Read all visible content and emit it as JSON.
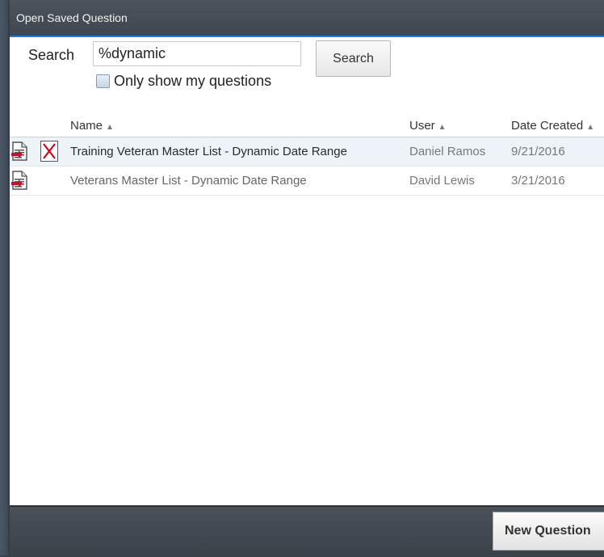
{
  "dialog": {
    "title": "Open Saved Question"
  },
  "search": {
    "label": "Search",
    "value": "%dynamic",
    "button_label": "Search",
    "only_mine_label": "Only show my questions",
    "only_mine_checked": false
  },
  "table": {
    "columns": [
      {
        "label": "Name",
        "sort": "asc"
      },
      {
        "label": "User",
        "sort": "asc"
      },
      {
        "label": "Date Created",
        "sort": "asc"
      }
    ],
    "rows": [
      {
        "name": "Training Veteran Master List - Dynamic Date Range",
        "user": "Daniel Ramos",
        "date": "9/21/2016",
        "deletable": true,
        "selected": true
      },
      {
        "name": "Veterans Master List - Dynamic Date Range",
        "user": "David Lewis",
        "date": "3/21/2016",
        "deletable": false,
        "selected": false
      }
    ]
  },
  "footer": {
    "new_question_label": "New Question"
  },
  "icons": {
    "open": "document-open-icon",
    "delete": "delete-x-icon",
    "sort": "sort-ascending-icon"
  },
  "colors": {
    "accent": "#1e7fd0",
    "titlebar": "#464d56",
    "delete": "#d0021b",
    "selected_row": "#eef3fa"
  }
}
